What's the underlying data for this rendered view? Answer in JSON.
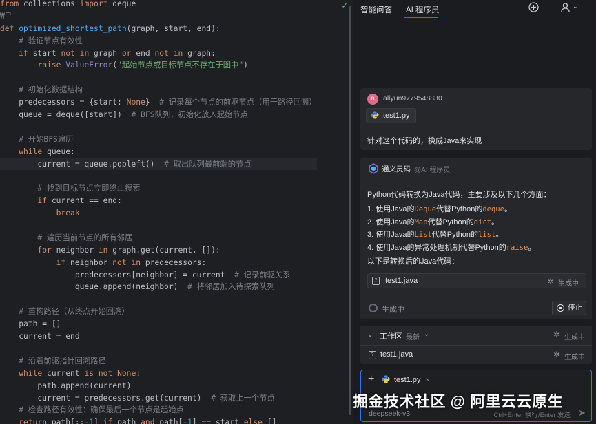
{
  "editor": {
    "status_icon": "check-icon",
    "lines": [
      [
        {
          "t": "from",
          "c": "kw"
        },
        {
          "t": " collections ",
          "c": "txt"
        },
        {
          "t": "import",
          "c": "kw"
        },
        {
          "t": " deque",
          "c": "txt"
        }
      ],
      [
        {
          "t": "₩ᄀ",
          "c": "cmt"
        }
      ],
      [
        {
          "t": "def ",
          "c": "kw"
        },
        {
          "t": "optimized_shortest_path",
          "c": "fn"
        },
        {
          "t": "(graph, start, end):",
          "c": "txt"
        }
      ],
      [
        {
          "t": "    # 验证节点有效性",
          "c": "cmt"
        }
      ],
      [
        {
          "t": "    ",
          "c": "txt"
        },
        {
          "t": "if",
          "c": "kw"
        },
        {
          "t": " start ",
          "c": "txt"
        },
        {
          "t": "not in",
          "c": "kw"
        },
        {
          "t": " graph ",
          "c": "txt"
        },
        {
          "t": "or",
          "c": "kw"
        },
        {
          "t": " end ",
          "c": "txt"
        },
        {
          "t": "not in",
          "c": "kw"
        },
        {
          "t": " graph:",
          "c": "txt"
        }
      ],
      [
        {
          "t": "        ",
          "c": "txt"
        },
        {
          "t": "raise",
          "c": "kw"
        },
        {
          "t": " ",
          "c": "txt"
        },
        {
          "t": "ValueError",
          "c": "bi"
        },
        {
          "t": "(",
          "c": "txt"
        },
        {
          "t": "\"起始节点或目标节点不存在于图中\"",
          "c": "str"
        },
        {
          "t": ")",
          "c": "txt"
        }
      ],
      [],
      [
        {
          "t": "    # 初始化数据结构",
          "c": "cmt"
        }
      ],
      [
        {
          "t": "    predecessors = {start: ",
          "c": "txt"
        },
        {
          "t": "None",
          "c": "kw"
        },
        {
          "t": "}  ",
          "c": "txt"
        },
        {
          "t": "# 记录每个节点的前驱节点（用于路径回溯）",
          "c": "cmt"
        }
      ],
      [
        {
          "t": "    queue = deque([start])  ",
          "c": "txt"
        },
        {
          "t": "# BFS队列，初始化放入起始节点",
          "c": "cmt"
        }
      ],
      [],
      [
        {
          "t": "    # 开始BFS遍历",
          "c": "cmt"
        }
      ],
      [
        {
          "t": "    ",
          "c": "txt"
        },
        {
          "t": "while",
          "c": "kw"
        },
        {
          "t": " queue:",
          "c": "txt"
        }
      ],
      [
        {
          "t": "        current = queue.popleft()  ",
          "c": "txt"
        },
        {
          "t": "# 取出队列最前端的节点",
          "c": "cmt"
        }
      ],
      [],
      [
        {
          "t": "        # 找到目标节点立即终止搜索",
          "c": "cmt"
        }
      ],
      [
        {
          "t": "        ",
          "c": "txt"
        },
        {
          "t": "if",
          "c": "kw"
        },
        {
          "t": " current == end:",
          "c": "txt"
        }
      ],
      [
        {
          "t": "            ",
          "c": "txt"
        },
        {
          "t": "break",
          "c": "kw"
        }
      ],
      [],
      [
        {
          "t": "        # 遍历当前节点的所有邻居",
          "c": "cmt"
        }
      ],
      [
        {
          "t": "        ",
          "c": "txt"
        },
        {
          "t": "for",
          "c": "kw"
        },
        {
          "t": " neighbor ",
          "c": "txt"
        },
        {
          "t": "in",
          "c": "kw"
        },
        {
          "t": " graph.get(current, []):",
          "c": "txt"
        }
      ],
      [
        {
          "t": "            ",
          "c": "txt"
        },
        {
          "t": "if",
          "c": "kw"
        },
        {
          "t": " neighbor ",
          "c": "txt"
        },
        {
          "t": "not in",
          "c": "kw"
        },
        {
          "t": " predecessors:",
          "c": "txt"
        }
      ],
      [
        {
          "t": "                predecessors[neighbor] = current  ",
          "c": "txt"
        },
        {
          "t": "# 记录前驱关系",
          "c": "cmt"
        }
      ],
      [
        {
          "t": "                queue.append(neighbor)  ",
          "c": "txt"
        },
        {
          "t": "# 将邻居加入待探索队列",
          "c": "cmt"
        }
      ],
      [],
      [
        {
          "t": "    # 重构路径（从终点开始回溯）",
          "c": "cmt"
        }
      ],
      [
        {
          "t": "    path = []",
          "c": "txt"
        }
      ],
      [
        {
          "t": "    current = end",
          "c": "txt"
        }
      ],
      [],
      [
        {
          "t": "    # 沿着前驱指针回溯路径",
          "c": "cmt"
        }
      ],
      [
        {
          "t": "    ",
          "c": "txt"
        },
        {
          "t": "while",
          "c": "kw"
        },
        {
          "t": " current ",
          "c": "txt"
        },
        {
          "t": "is not",
          "c": "kw"
        },
        {
          "t": " ",
          "c": "txt"
        },
        {
          "t": "None",
          "c": "kw"
        },
        {
          "t": ":",
          "c": "txt"
        }
      ],
      [
        {
          "t": "        path.append(current)",
          "c": "txt"
        }
      ],
      [
        {
          "t": "        current = predecessors.get(current)  ",
          "c": "txt"
        },
        {
          "t": "# 获取上一个节点",
          "c": "cmt"
        }
      ],
      [
        {
          "t": "    # 检查路径有效性：确保最后一个节点是起始点",
          "c": "cmt"
        }
      ],
      [
        {
          "t": "    ",
          "c": "txt"
        },
        {
          "t": "return",
          "c": "kw"
        },
        {
          "t": " path[::",
          "c": "txt"
        },
        {
          "t": "-1",
          "c": "num"
        },
        {
          "t": "] ",
          "c": "txt"
        },
        {
          "t": "if",
          "c": "kw"
        },
        {
          "t": " path ",
          "c": "txt"
        },
        {
          "t": "and",
          "c": "kw"
        },
        {
          "t": " path[",
          "c": "txt"
        },
        {
          "t": "-1",
          "c": "num"
        },
        {
          "t": "] == start ",
          "c": "txt"
        },
        {
          "t": "else",
          "c": "kw"
        },
        {
          "t": " []",
          "c": "txt"
        }
      ]
    ]
  },
  "panel": {
    "tabs": [
      "智能问答",
      "AI 程序员"
    ],
    "active_tab": 1,
    "user": {
      "avatar_letter": "a",
      "name": "aliyun9779548830"
    },
    "attached_file": "test1.py",
    "question": "针对这个代码的，换成Java来实现",
    "bot": {
      "name": "通义灵码",
      "tag": "@AI 程序员"
    },
    "intro": "Python代码转换为Java代码，主要涉及以下几个方面：",
    "points": [
      {
        "n": "1.",
        "a": "使用Java的",
        "code1": "Deque",
        "b": "代替Python的",
        "code2": "deque",
        "c": "。"
      },
      {
        "n": "2.",
        "a": "使用Java的",
        "code1": "Map",
        "b": "代替Python的",
        "code2": "dict",
        "c": "。"
      },
      {
        "n": "3.",
        "a": "使用Java的",
        "code1": "List",
        "b": "代替Python的",
        "code2": "list",
        "c": "。"
      },
      {
        "n": "4.",
        "a": "使用Java的异常处理机制代替Python的",
        "code1": "",
        "b": "",
        "code2": "raise",
        "c": "。"
      }
    ],
    "after": "以下是转换后的Java代码：",
    "generated_file": "test1.java",
    "generating": "生成中",
    "stop_label": "停止",
    "workspace": {
      "title": "工作区",
      "sub": "最新",
      "status": "生成中",
      "file": "test1.java",
      "file_status": "生成中"
    },
    "input": {
      "chip": "test1.py",
      "model": "deepseek-v3",
      "hint": "Ctrl+Enter 换行/Enter 发送"
    }
  },
  "watermark": "掘金技术社区 @ 阿里云云原生"
}
